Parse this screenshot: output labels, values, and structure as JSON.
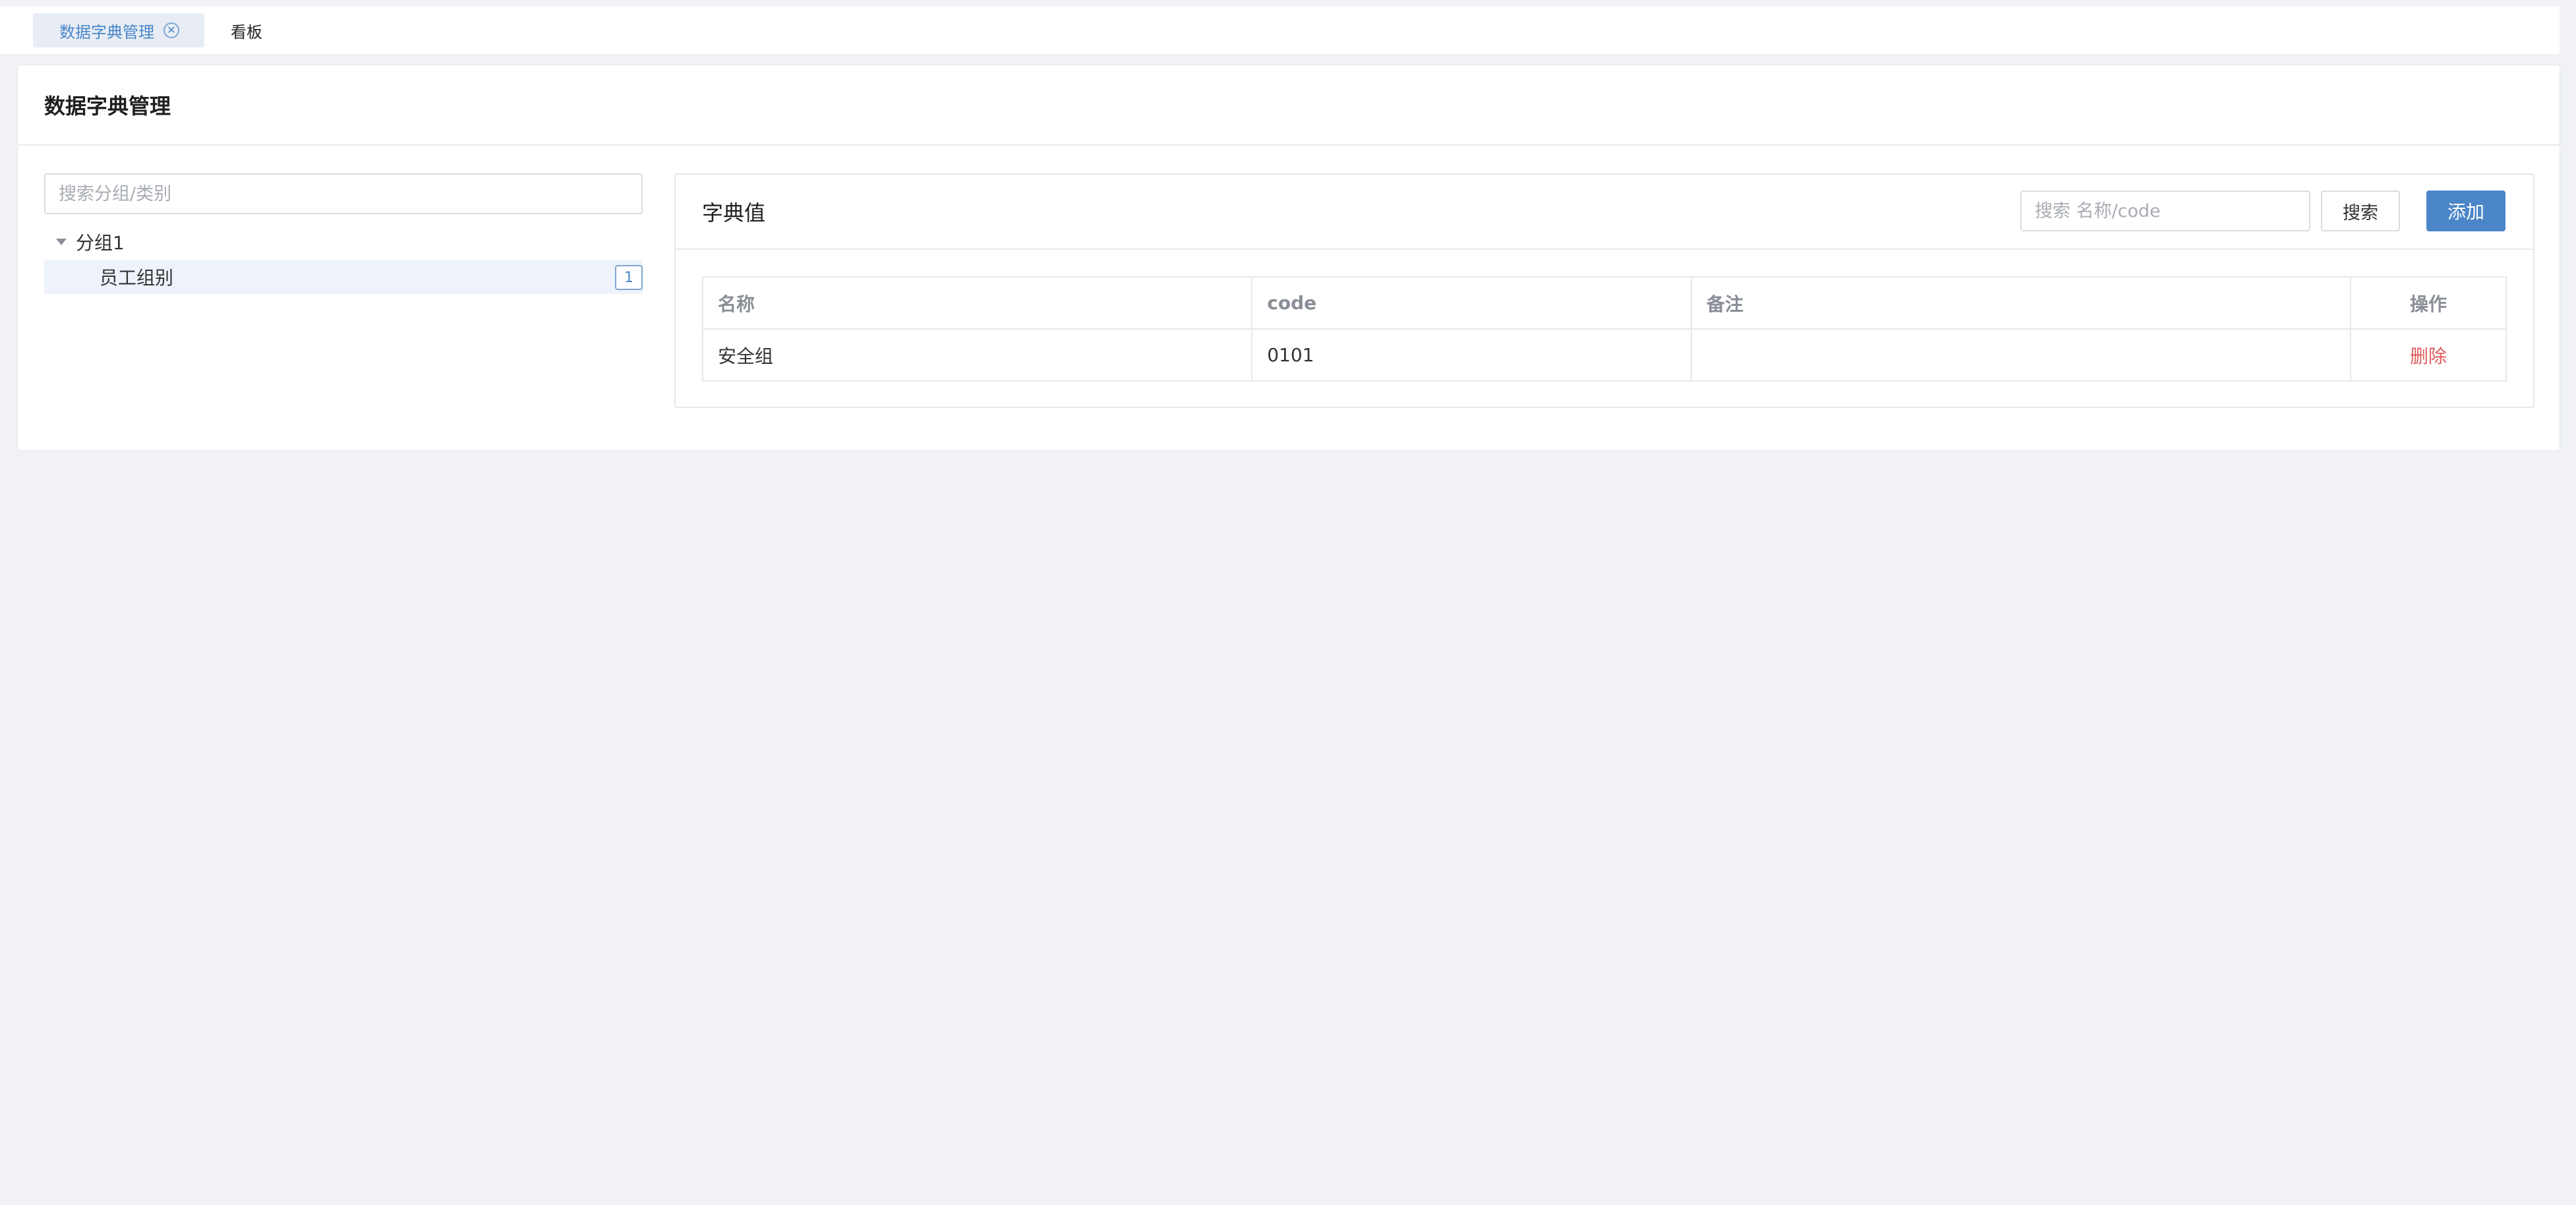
{
  "tabs": [
    {
      "label": "数据字典管理",
      "active": true
    },
    {
      "label": "看板",
      "active": false
    }
  ],
  "panel": {
    "title": "数据字典管理"
  },
  "tree": {
    "search_placeholder": "搜索分组/类别",
    "groups": [
      {
        "label": "分组1",
        "items": [
          {
            "label": "员工组别",
            "count": "1"
          }
        ]
      }
    ]
  },
  "card": {
    "title": "字典值",
    "search_placeholder": "搜索 名称/code",
    "search_button": "搜索",
    "add_button": "添加"
  },
  "table": {
    "headers": [
      "名称",
      "code",
      "备注",
      "操作"
    ],
    "rows": [
      {
        "name": "安全组",
        "code": "0101",
        "remark": "",
        "action": "删除"
      }
    ]
  },
  "colors": {
    "accent": "#4a86c8",
    "danger": "#e05b5b",
    "background": "#f0f2f5"
  }
}
